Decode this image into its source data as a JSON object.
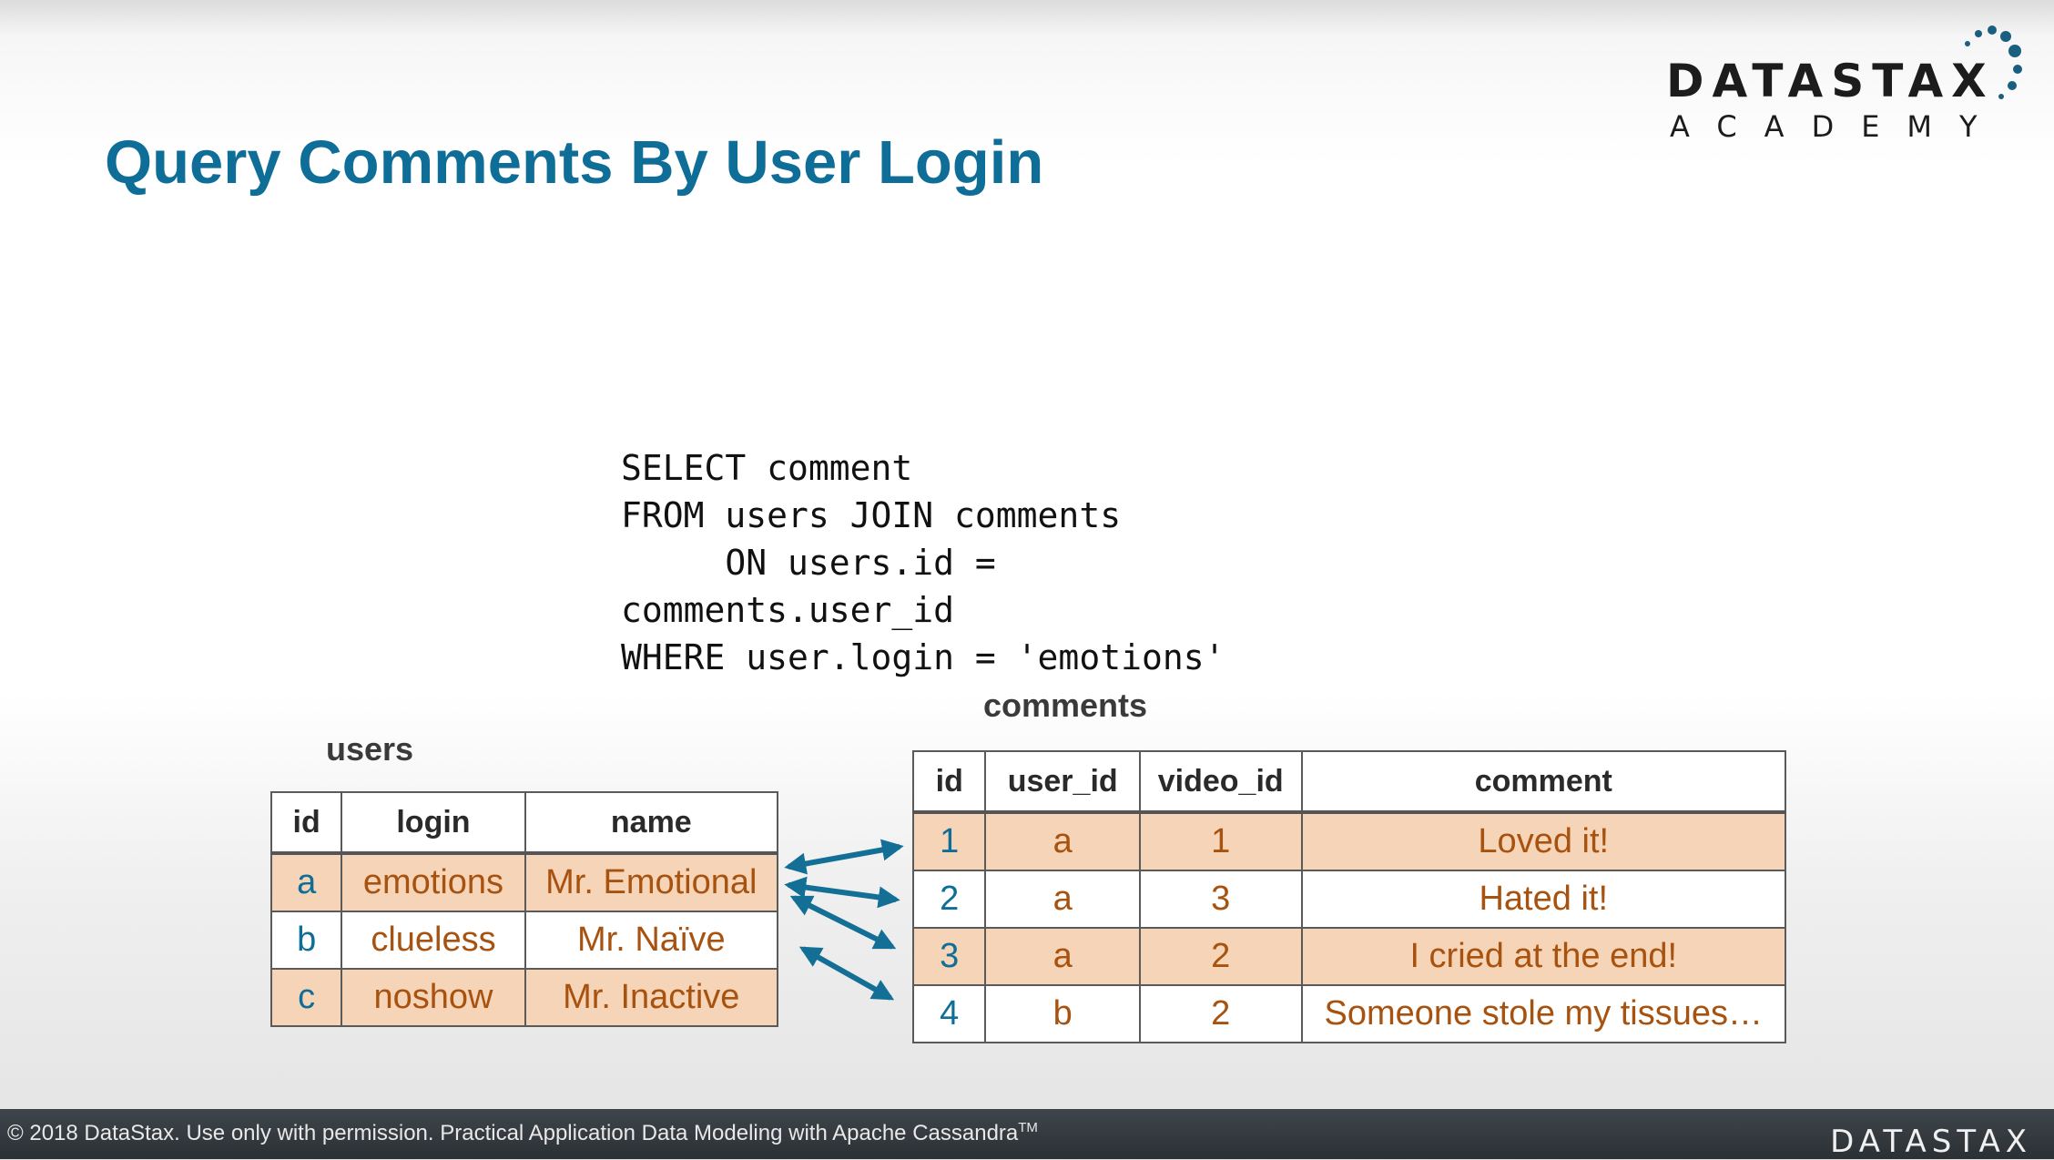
{
  "slide": {
    "title": "Query Comments By User Login",
    "sql": "SELECT comment\nFROM users JOIN comments\n     ON users.id =\ncomments.user_id\nWHERE user.login = 'emotions'"
  },
  "logo": {
    "word": "DATASTAX",
    "sub": "ACADEMY"
  },
  "users_table": {
    "title": "users",
    "headers": [
      "id",
      "login",
      "name"
    ],
    "rows": [
      {
        "id": "a",
        "login": "emotions",
        "name": "Mr. Emotional",
        "highlighted": true
      },
      {
        "id": "b",
        "login": "clueless",
        "name": "Mr. Naïve",
        "highlighted": false
      },
      {
        "id": "c",
        "login": "noshow",
        "name": "Mr. Inactive",
        "highlighted": true
      }
    ]
  },
  "comments_table": {
    "title": "comments",
    "headers": [
      "id",
      "user_id",
      "video_id",
      "comment"
    ],
    "rows": [
      {
        "id": "1",
        "user_id": "a",
        "video_id": "1",
        "comment": "Loved it!",
        "highlighted": true
      },
      {
        "id": "2",
        "user_id": "a",
        "video_id": "3",
        "comment": "Hated it!",
        "highlighted": false
      },
      {
        "id": "3",
        "user_id": "a",
        "video_id": "2",
        "comment": "I cried at the end!",
        "highlighted": true
      },
      {
        "id": "4",
        "user_id": "b",
        "video_id": "2",
        "comment": "Someone stole my tissues…",
        "highlighted": false
      }
    ]
  },
  "colors": {
    "title": "#0f6e97",
    "key_text": "#0f6e97",
    "value_text": "#a8520f",
    "row_highlight": "#f6d4b8",
    "arrow": "#146f96"
  },
  "footer": {
    "text": "© 2018 DataStax. Use only with permission. Practical Application Data Modeling with Apache Cassandra",
    "trademark": "TM",
    "logo": "DATASTAX"
  }
}
